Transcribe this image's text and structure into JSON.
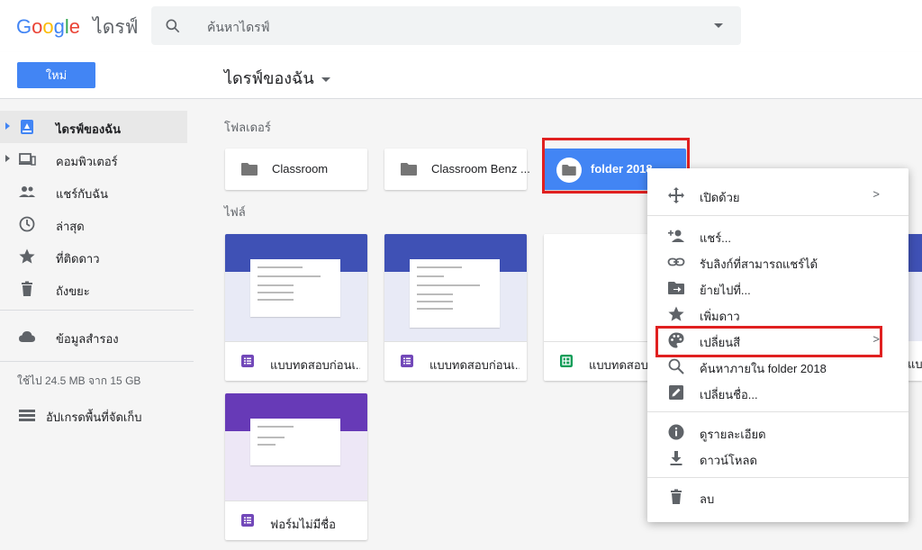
{
  "header": {
    "logo_letters": [
      "G",
      "o",
      "o",
      "g",
      "l",
      "e"
    ],
    "product": "ไดรฟ์",
    "search_placeholder": "ค้นหาไดรฟ์"
  },
  "toolbar": {
    "new_label": "ใหม่",
    "title": "ไดรฟ์ของฉัน"
  },
  "sidebar": {
    "items": [
      {
        "label": "ไดรฟ์ของฉัน",
        "icon": "drive-icon",
        "active": true
      },
      {
        "label": "คอมพิวเตอร์",
        "icon": "computer-icon"
      },
      {
        "label": "แชร์กับฉัน",
        "icon": "people-icon"
      },
      {
        "label": "ล่าสุด",
        "icon": "clock-icon"
      },
      {
        "label": "ที่ติดดาว",
        "icon": "star-icon"
      },
      {
        "label": "ถังขยะ",
        "icon": "trash-icon"
      }
    ],
    "backup_label": "ข้อมูลสำรอง",
    "storage_text": "ใช้ไป 24.5 MB จาก 15 GB",
    "upgrade_label": "อัปเกรดพื้นที่จัดเก็บ"
  },
  "main": {
    "folders_label": "โฟลเดอร์",
    "files_label": "ไฟล์",
    "folders": [
      {
        "name": "Classroom"
      },
      {
        "name": "Classroom Benz ..."
      },
      {
        "name": "folder 2018"
      }
    ],
    "files": [
      {
        "name": "แบบทดสอบก่อนเ...",
        "icon": "forms-icon",
        "color": "#7248b9",
        "band": "#3f51b5"
      },
      {
        "name": "แบบทดสอบก่อนเ...",
        "icon": "forms-icon",
        "color": "#7248b9",
        "band": "#3f51b5"
      },
      {
        "name": "แบบทดสอบก",
        "icon": "sheets-icon",
        "color": "#0f9d58",
        "band": "#ffffff"
      },
      {
        "name": "ฟอร์มไม่มีชื่อ",
        "icon": "forms-icon",
        "color": "#7248b9",
        "band": "#673ab7"
      }
    ],
    "partial_file_label": "แบ"
  },
  "context_menu": {
    "items": [
      {
        "label": "เปิดด้วย",
        "icon": "open-with-icon",
        "submenu": ">"
      },
      {
        "label": "แชร์...",
        "icon": "share-person-icon"
      },
      {
        "label": "รับลิงก์ที่สามารถแชร์ได้",
        "icon": "link-icon"
      },
      {
        "label": "ย้ายไปที่...",
        "icon": "move-folder-icon"
      },
      {
        "label": "เพิ่มดาว",
        "icon": "star-icon"
      },
      {
        "label": "เปลี่ยนสี",
        "icon": "palette-icon",
        "submenu": ">"
      },
      {
        "label": "ค้นหาภายใน folder 2018",
        "icon": "search-icon"
      },
      {
        "label": "เปลี่ยนชื่อ...",
        "icon": "rename-icon"
      },
      {
        "label": "ดูรายละเอียด",
        "icon": "info-icon"
      },
      {
        "label": "ดาวน์โหลด",
        "icon": "download-icon"
      },
      {
        "label": "ลบ",
        "icon": "trash-icon"
      }
    ]
  },
  "colors": {
    "accent": "#4285f4",
    "highlight_box": "#e02020"
  }
}
